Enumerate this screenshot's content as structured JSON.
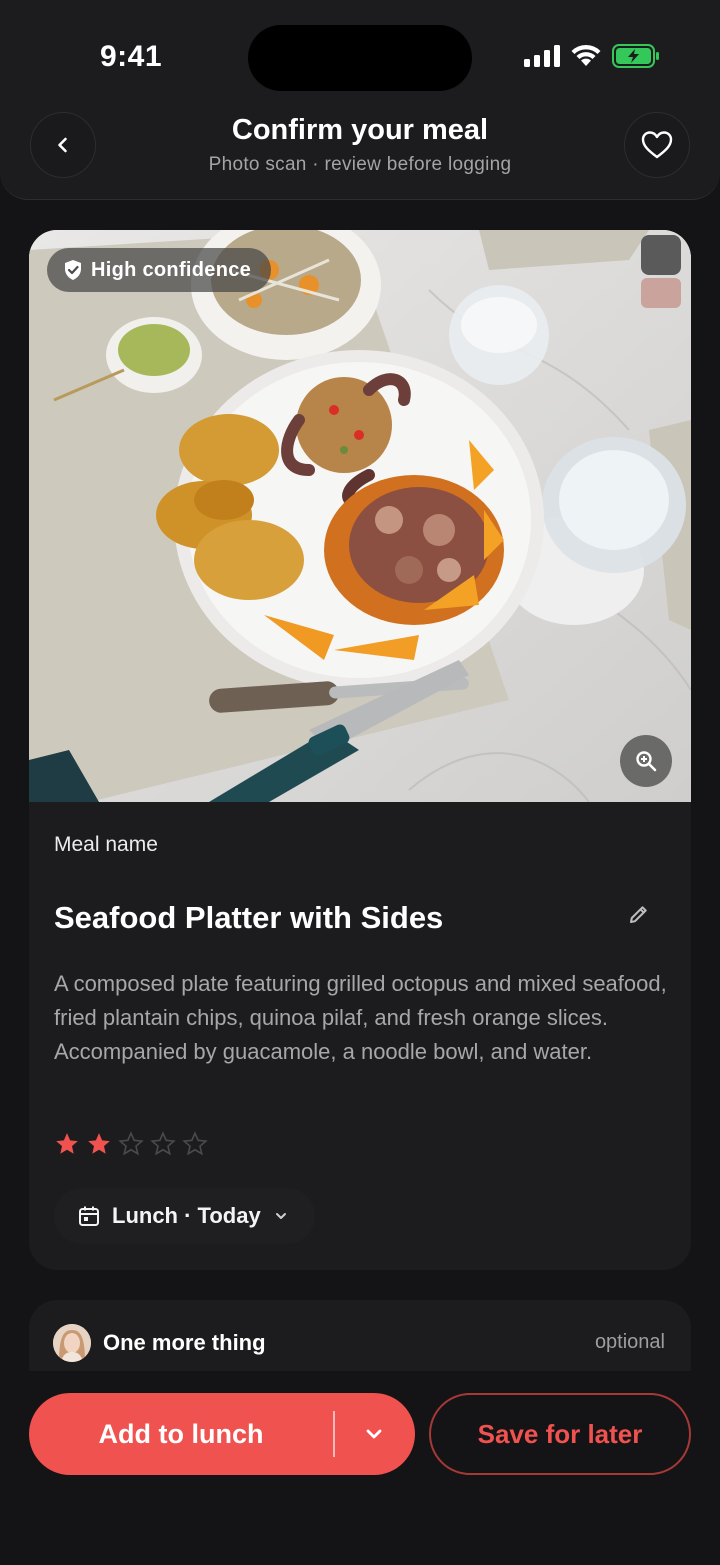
{
  "status_bar": {
    "time": "9:41"
  },
  "header": {
    "title": "Confirm your meal",
    "subtitle": "Photo scan · review before logging"
  },
  "photo": {
    "confidence_badge": "High confidence",
    "description_icon": "meal-photo"
  },
  "meal": {
    "label": "Meal name",
    "name": "Seafood Platter with Sides",
    "description": "A composed plate featuring grilled octopus and mixed seafood, fried plantain chips, quinoa pilaf, and fresh orange slices. Accompanied by guacamole, a noodle bowl, and water.",
    "rating": 2,
    "rating_max": 5,
    "meal_slot": "Lunch · Today"
  },
  "more": {
    "title": "One more thing",
    "optional_label": "optional"
  },
  "actions": {
    "primary_label": "Add to lunch",
    "secondary_label": "Save for later"
  },
  "colors": {
    "accent": "#f0524f",
    "background": "#141416",
    "card": "#1c1c1e",
    "battery": "#34c759"
  }
}
